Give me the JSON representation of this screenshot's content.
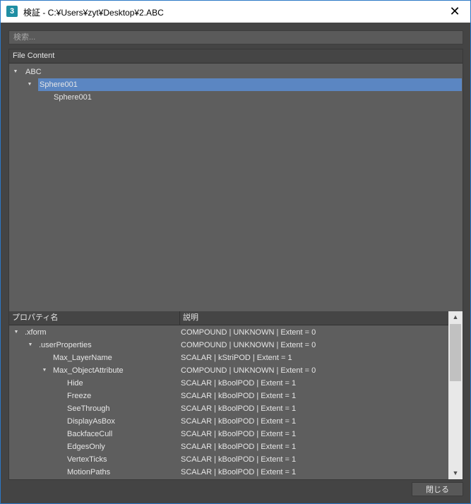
{
  "window": {
    "title": "検証 - C:¥Users¥zyt¥Desktop¥2.ABC",
    "app_icon_text": "3",
    "close_glyph": "✕"
  },
  "search": {
    "placeholder": "検索..."
  },
  "file_content": {
    "header": "File Content",
    "tree": [
      {
        "label": "ABC",
        "depth": 0,
        "expanded": true,
        "has_children": true,
        "selected": false
      },
      {
        "label": "Sphere001",
        "depth": 1,
        "expanded": true,
        "has_children": true,
        "selected": true
      },
      {
        "label": "Sphere001",
        "depth": 2,
        "expanded": false,
        "has_children": false,
        "selected": false
      }
    ]
  },
  "properties": {
    "columns": [
      "プロパティ名",
      "説明"
    ],
    "rows": [
      {
        "name": ".xform",
        "depth": 0,
        "expanded": true,
        "description": "COMPOUND | UNKNOWN | Extent = 0"
      },
      {
        "name": ".userProperties",
        "depth": 1,
        "expanded": true,
        "description": "COMPOUND | UNKNOWN | Extent = 0"
      },
      {
        "name": "Max_LayerName",
        "depth": 2,
        "description": "SCALAR | kStriPOD | Extent = 1"
      },
      {
        "name": "Max_ObjectAttribute",
        "depth": 2,
        "expanded": true,
        "description": "COMPOUND | UNKNOWN | Extent = 0"
      },
      {
        "name": "Hide",
        "depth": 3,
        "description": "SCALAR | kBoolPOD | Extent = 1"
      },
      {
        "name": "Freeze",
        "depth": 3,
        "description": "SCALAR | kBoolPOD | Extent = 1"
      },
      {
        "name": "SeeThrough",
        "depth": 3,
        "description": "SCALAR | kBoolPOD | Extent = 1"
      },
      {
        "name": "DisplayAsBox",
        "depth": 3,
        "description": "SCALAR | kBoolPOD | Extent = 1"
      },
      {
        "name": "BackfaceCull",
        "depth": 3,
        "description": "SCALAR | kBoolPOD | Extent = 1"
      },
      {
        "name": "EdgesOnly",
        "depth": 3,
        "description": "SCALAR | kBoolPOD | Extent = 1"
      },
      {
        "name": "VertexTicks",
        "depth": 3,
        "description": "SCALAR | kBoolPOD | Extent = 1"
      },
      {
        "name": "MotionPaths",
        "depth": 3,
        "description": "SCALAR | kBoolPOD | Extent = 1"
      }
    ]
  },
  "scrollbar": {
    "up_glyph": "▲",
    "down_glyph": "▼",
    "position": 0,
    "visible_fraction": 0.4
  },
  "footer": {
    "close_label": "閉じる"
  },
  "colors": {
    "selection": "#5b86c2",
    "panel": "#5e5e5e",
    "chrome": "#444444"
  }
}
